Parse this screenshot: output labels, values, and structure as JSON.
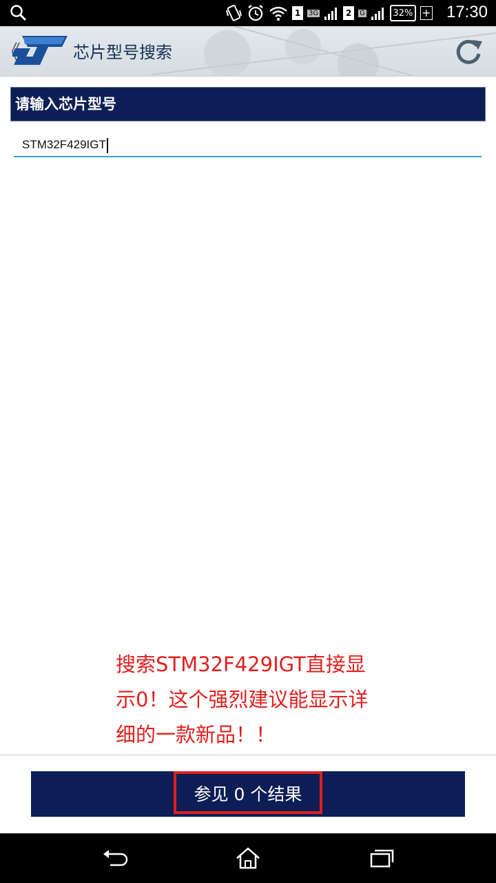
{
  "status_bar": {
    "time": "17:30",
    "battery": "32%",
    "sim1": "1",
    "sim1_network": "3G",
    "sim2": "2",
    "sim2_network": "G"
  },
  "app_bar": {
    "title": "芯片型号搜索",
    "back_glyph": "《"
  },
  "search": {
    "header_label": "请输入芯片型号",
    "input_value": "STM32F429IGT"
  },
  "annotation": {
    "lines": [
      "搜索STM32F429IGT直接显",
      "示0！这个强烈建议能显示详",
      "细的一款新品！！"
    ]
  },
  "results_button": {
    "label": "参见 0 个结果"
  },
  "colors": {
    "navy": "#0d1e56",
    "annotation_red": "#e0201e",
    "input_underline": "#33a2c8"
  },
  "icons": [
    "search-icon",
    "vibrate-icon",
    "alarm-icon",
    "wifi-icon",
    "signal-icon",
    "battery-icon",
    "st-logo",
    "refresh-icon",
    "back-icon",
    "home-icon",
    "recent-apps-icon"
  ]
}
